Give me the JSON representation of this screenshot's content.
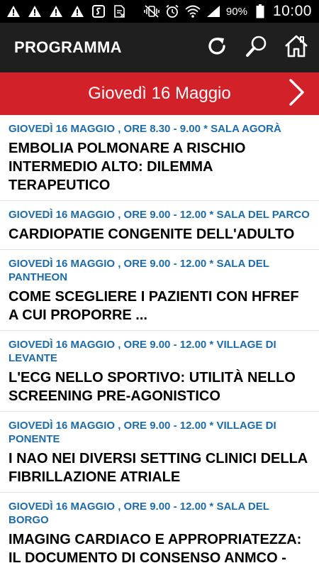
{
  "status_bar": {
    "left_icons": [
      "warning-icon",
      "warning-icon",
      "warning-icon",
      "warning-icon",
      "app-notification-icon",
      "document-icon"
    ],
    "right_icons": [
      "vibrate-mute-icon",
      "alarm-icon",
      "wifi-icon",
      "signal-icon"
    ],
    "battery_percent": "90%",
    "time": "10:00"
  },
  "toolbar": {
    "title": "PROGRAMMA",
    "icons": [
      "refresh-icon",
      "search-icon",
      "home-icon"
    ]
  },
  "date_bar": {
    "label": "Giovedì 16 Maggio",
    "next_icon": "chevron-right-icon"
  },
  "sessions": [
    {
      "meta": "GIOVEDÌ 16 MAGGIO , ORE 8.30 - 9.00 * SALA AGORÀ",
      "title": "EMBOLIA POLMONARE A RISCHIO INTERMEDIO ALTO: DILEMMA TERAPEUTICO"
    },
    {
      "meta": "GIOVEDÌ 16 MAGGIO , ORE 9.00 - 12.00 * SALA DEL PARCO",
      "title": "CARDIOPATIE CONGENITE DELL'ADULTO"
    },
    {
      "meta": "GIOVEDÌ 16 MAGGIO , ORE 9.00 - 12.00 * SALA DEL PANTHEON",
      "title": "COME SCEGLIERE I PAZIENTI CON HFrEF A CUI PROPORRE ..."
    },
    {
      "meta": "GIOVEDÌ 16 MAGGIO , ORE 9.00 - 12.00 * VILLAGE DI LEVANTE",
      "title": "L'ECG NELLO SPORTIVO: UTILITÀ NELLO SCREENING PRE-AGONISTICO"
    },
    {
      "meta": "GIOVEDÌ 16 MAGGIO , ORE 9.00 - 12.00 * VILLAGE DI PONENTE",
      "title": "I NAO NEI DIVERSI SETTING CLINICI DELLA FIBRILLAZIONE ATRIALE"
    },
    {
      "meta": "GIOVEDÌ 16 MAGGIO , ORE 9.00 - 12.00 * SALA DEL BORGO",
      "title": "IMAGING CARDIACO E APPROPRIATEZZA: IL DOCUMENTO DI CONSENSO ANMCO -"
    }
  ],
  "colors": {
    "toolbar_bg": "#1f1f1f",
    "date_bar_bg": "#d32129",
    "meta_text": "#1e6ba8",
    "title_text": "#000000"
  }
}
